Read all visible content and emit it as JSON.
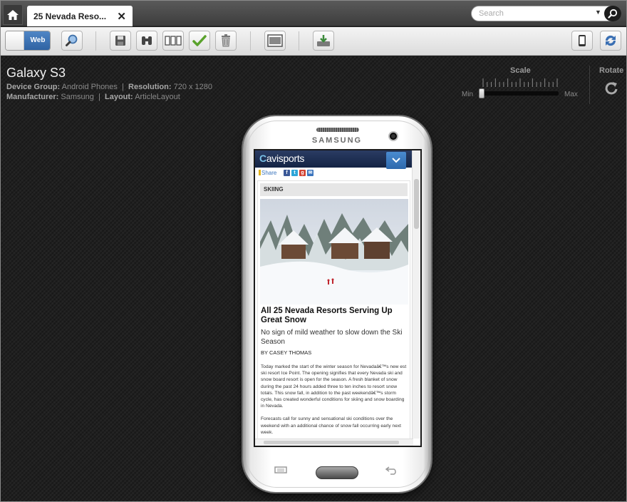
{
  "tabbar": {
    "tab_title": "25 Nevada Reso...",
    "close_glyph": "✕",
    "search_placeholder": "Search"
  },
  "toolbar": {
    "web_label": "Web",
    "buttons": [
      "zoom-icon",
      "save-icon",
      "binoculars-icon",
      "layout-icon",
      "checkmark-icon",
      "trash-icon",
      "frame-icon",
      "import-icon",
      "device-icon",
      "sync-icon"
    ]
  },
  "device": {
    "name": "Galaxy S3",
    "group_label": "Device Group:",
    "group_value": "Android Phones",
    "resolution_label": "Resolution:",
    "resolution_value": "720 x 1280",
    "manufacturer_label": "Manufacturer:",
    "manufacturer_value": "Samsung",
    "layout_label": "Layout:",
    "layout_value": "ArticleLayout",
    "separator": "|"
  },
  "scale": {
    "label": "Scale",
    "min_label": "Min",
    "max_label": "Max",
    "level": 0
  },
  "rotate": {
    "label": "Rotate"
  },
  "phone": {
    "brand": "SAMSUNG"
  },
  "site": {
    "logo_mark": "C",
    "logo_text": "avisports",
    "share_label": "Share",
    "category": "SKIING",
    "headline": "All 25 Nevada Resorts Serving Up Great Snow",
    "subhead": "No sign of mild weather to slow down the Ski Season",
    "byline": "BY  CASEY THOMAS",
    "paragraphs": [
      "Today marked the start of the winter season for Nevadaâ€™s new est ski resort Ice Point. The opening signifies that every Nevada ski and snow board resort is open for the season. A fresh blanket of snow during the past 24 hours added three to ten inches to resort snow totals. This snow fall, in addition to the past weekendâ€™s storm cycle, has created wonderful conditions for skiing and snow boarding in Nevada.",
      "Forecasts call for sunny and sensational ski conditions over the weekend with an additional chance of snow fall occurring early next week."
    ]
  },
  "colors": {
    "accent_blue": "#3a74bd",
    "header_navy": "#142344",
    "background": "#1e1e1e"
  }
}
